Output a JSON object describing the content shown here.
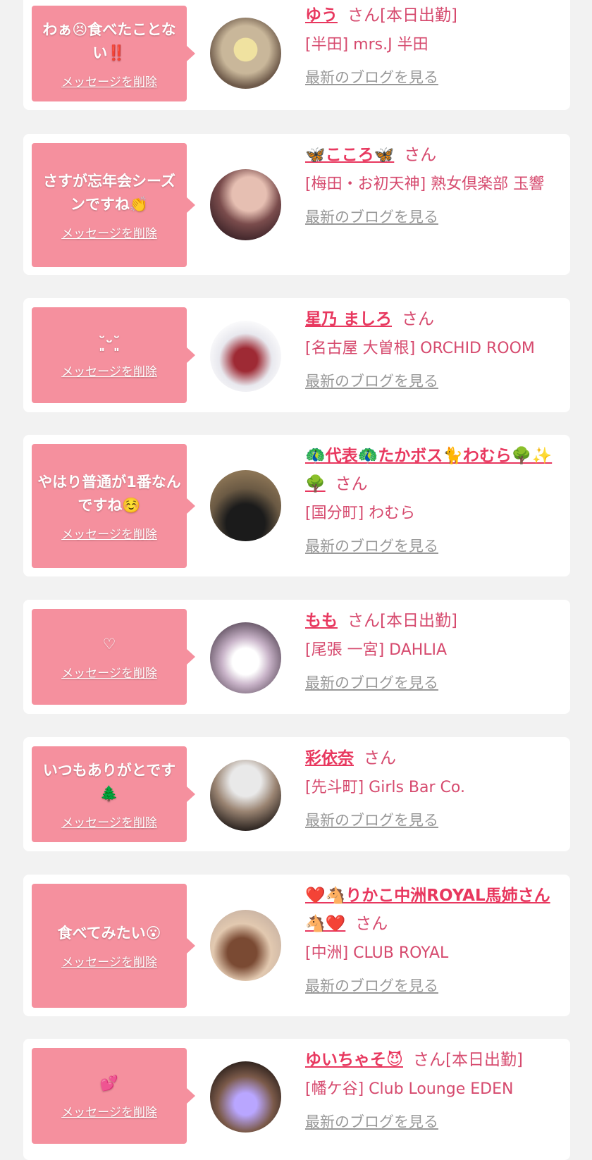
{
  "colors": {
    "bubble": "#f5909e",
    "name": "#e8385f",
    "text": "#d64a6e",
    "link_gray": "#999999",
    "background": "#f2f2f2"
  },
  "delete_label": "メッセージを削除",
  "blog_label": "最新のブログを見る",
  "san_label": "さん",
  "messages": [
    {
      "bubble": "わぁ😣食べたことない‼️",
      "name": "ゆう",
      "suffix": "さん[本日出勤]",
      "shop": "[半田] mrs.J 半田"
    },
    {
      "bubble": "さすが忘年会シーズンですね👏",
      "name": "🦋こころ🦋",
      "suffix": "さん",
      "shop": "[梅田・お初天神] 熟女倶楽部 玉響"
    },
    {
      "bubble": "˘͈ᵕ˘͈",
      "name": "星乃 ましろ",
      "suffix": "さん",
      "shop": "[名古屋 大曽根] ORCHID ROOM"
    },
    {
      "bubble": "やはり普通が1番なんですね☺️",
      "name": "🦚代表🦚たかボス🐈わむら🌳✨🌳",
      "suffix": "さん",
      "shop": "[国分町] わむら"
    },
    {
      "bubble": "♡",
      "name": "もも",
      "suffix": "さん[本日出勤]",
      "shop": "[尾張 一宮] DAHLIA"
    },
    {
      "bubble": "いつもありがとです🌲",
      "name": "彩依奈",
      "suffix": "さん",
      "shop": "[先斗町] Girls Bar Co."
    },
    {
      "bubble": "食べてみたい😮",
      "name": "❤️🐴りかこ中洲ROYAL馬姉さん🐴❤️",
      "suffix": "さん",
      "shop": "[中洲] CLUB ROYAL"
    },
    {
      "bubble": "💕",
      "name": "ゆいちゃそ😈",
      "suffix": "さん[本日出勤]",
      "shop": "[幡ケ谷] Club Lounge EDEN"
    }
  ]
}
